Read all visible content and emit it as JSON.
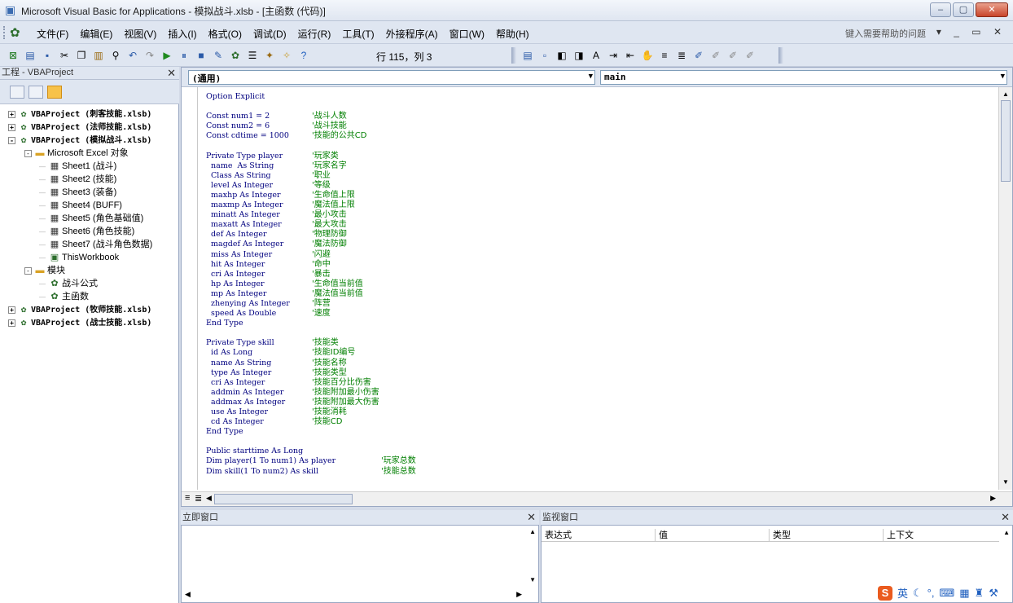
{
  "window": {
    "title": "Microsoft Visual Basic for Applications - 模拟战斗.xlsb - [主函数 (代码)]",
    "controls": [
      "–",
      "▢",
      "✕"
    ]
  },
  "menu": {
    "items": [
      "文件(F)",
      "编辑(E)",
      "视图(V)",
      "插入(I)",
      "格式(O)",
      "调试(D)",
      "运行(R)",
      "工具(T)",
      "外接程序(A)",
      "窗口(W)",
      "帮助(H)"
    ],
    "help_placeholder": "键入需要帮助的问题",
    "right_controls": "▾ _ ▭ ✕"
  },
  "toolbar": {
    "position_label": "行 115，列 3"
  },
  "project": {
    "title": "工程 - VBAProject",
    "close": "✕",
    "nodes": [
      {
        "text": "VBAProject (刺客技能.xlsb)",
        "exp": "+",
        "icon": "vbaproject-icon"
      },
      {
        "text": "VBAProject (法师技能.xlsb)",
        "exp": "+",
        "icon": "vbaproject-icon"
      },
      {
        "text": "VBAProject (模拟战斗.xlsb)",
        "exp": "-",
        "icon": "vbaproject-icon"
      },
      {
        "text": "Microsoft Excel 对象",
        "exp": "-",
        "icon": "folder-icon"
      },
      {
        "text": "Sheet1 (战斗)",
        "icon": "sheet-icon"
      },
      {
        "text": "Sheet2 (技能)",
        "icon": "sheet-icon"
      },
      {
        "text": "Sheet3 (装备)",
        "icon": "sheet-icon"
      },
      {
        "text": "Sheet4 (BUFF)",
        "icon": "sheet-icon"
      },
      {
        "text": "Sheet5 (角色基础值)",
        "icon": "sheet-icon"
      },
      {
        "text": "Sheet6 (角色技能)",
        "icon": "sheet-icon"
      },
      {
        "text": "Sheet7 (战斗角色数据)",
        "icon": "sheet-icon"
      },
      {
        "text": "ThisWorkbook",
        "icon": "workbook-icon"
      },
      {
        "text": "模块",
        "exp": "-",
        "icon": "folder-icon"
      },
      {
        "text": "战斗公式",
        "icon": "module-icon"
      },
      {
        "text": "主函数",
        "icon": "module-icon"
      },
      {
        "text": "VBAProject (牧师技能.xlsb)",
        "exp": "+",
        "icon": "vbaproject-icon"
      },
      {
        "text": "VBAProject (战士技能.xlsb)",
        "exp": "+",
        "icon": "vbaproject-icon"
      }
    ]
  },
  "code": {
    "object_combo": "(通用)",
    "proc_combo": "main",
    "lines": [
      {
        "c": "Option Explicit",
        "m": ""
      },
      {
        "c": "",
        "m": ""
      },
      {
        "c": "Const num1 = 2",
        "m": "'战斗人数"
      },
      {
        "c": "Const num2 = 6",
        "m": "'战斗技能"
      },
      {
        "c": "Const cdtime = 1000",
        "m": "'技能的公共CD"
      },
      {
        "c": "",
        "m": ""
      },
      {
        "c": "Private Type player",
        "m": "'玩家类"
      },
      {
        "c": "  name  As String",
        "m": "'玩家名字"
      },
      {
        "c": "  Class As String",
        "m": "'职业"
      },
      {
        "c": "  level As Integer",
        "m": "'等级"
      },
      {
        "c": "  maxhp As Integer",
        "m": "'生命值上限"
      },
      {
        "c": "  maxmp As Integer",
        "m": "'魔法值上限"
      },
      {
        "c": "  minatt As Integer",
        "m": "'最小攻击"
      },
      {
        "c": "  maxatt As Integer",
        "m": "'最大攻击"
      },
      {
        "c": "  def As Integer",
        "m": "'物理防御"
      },
      {
        "c": "  magdef As Integer",
        "m": "'魔法防御"
      },
      {
        "c": "  miss As Integer",
        "m": "'闪避"
      },
      {
        "c": "  hit As Integer",
        "m": "'命中"
      },
      {
        "c": "  cri As Integer",
        "m": "'暴击"
      },
      {
        "c": "  hp As Integer",
        "m": "'生命值当前值"
      },
      {
        "c": "  mp As Integer",
        "m": "'魔法值当前值"
      },
      {
        "c": "  zhenying As Integer",
        "m": "'阵营"
      },
      {
        "c": "  speed As Double",
        "m": "'速度"
      },
      {
        "c": "End Type",
        "m": ""
      },
      {
        "c": "",
        "m": ""
      },
      {
        "c": "Private Type skill",
        "m": "'技能类"
      },
      {
        "c": "  id As Long",
        "m": "'技能ID编号"
      },
      {
        "c": "  name As String",
        "m": "'技能名称"
      },
      {
        "c": "  type As Integer",
        "m": "'技能类型"
      },
      {
        "c": "  cri As Integer",
        "m": "'技能百分比伤害"
      },
      {
        "c": "  addmin As Integer",
        "m": "'技能附加最小伤害"
      },
      {
        "c": "  addmax As Integer",
        "m": "'技能附加最大伤害"
      },
      {
        "c": "  use As Integer",
        "m": "'技能消耗"
      },
      {
        "c": "  cd As Integer",
        "m": "'技能CD"
      },
      {
        "c": "End Type",
        "m": ""
      },
      {
        "c": "",
        "m": ""
      },
      {
        "c": "Public starttime As Long",
        "m": ""
      },
      {
        "c": "Dim player(1 To num1) As player",
        "m": "'玩家总数",
        "far": true
      },
      {
        "c": "Dim skill(1 To num2) As skill",
        "m": "'技能总数",
        "far": true
      }
    ]
  },
  "immediate": {
    "title": "立即窗口",
    "close": "✕"
  },
  "watch": {
    "title": "监视窗口",
    "close": "✕",
    "columns": [
      "表达式",
      "值",
      "类型",
      "上下文"
    ]
  },
  "ime": {
    "label": "英"
  }
}
